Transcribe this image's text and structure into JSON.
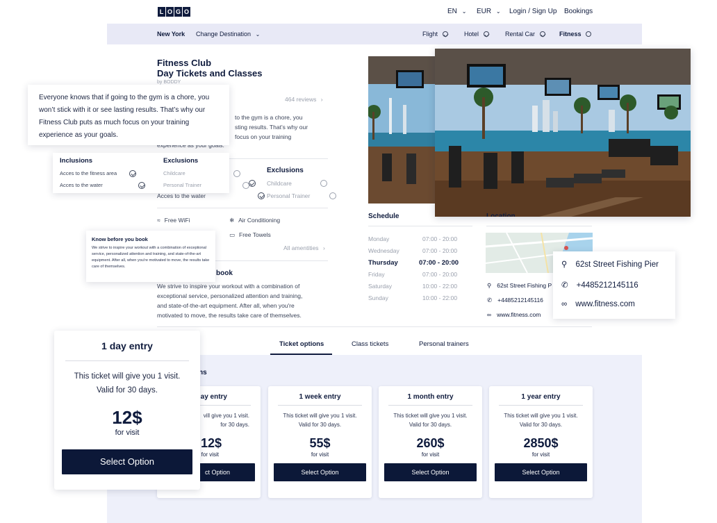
{
  "header": {
    "logo_letters": [
      "L",
      "O",
      "G",
      "O"
    ],
    "language": "EN",
    "currency": "EUR",
    "login_label": "Login / Sign Up",
    "bookings_label": "Bookings"
  },
  "subnav": {
    "city": "New York",
    "change_destination": "Change Destination",
    "items": [
      {
        "label": "Flight",
        "icon": "check-circle-icon"
      },
      {
        "label": "Hotel",
        "icon": "check-circle-icon"
      },
      {
        "label": "Rental Car",
        "icon": "check-circle-icon"
      },
      {
        "label": "Fitness",
        "icon": "empty-circle-icon"
      }
    ]
  },
  "listing": {
    "title_line1": "Fitness Club",
    "title_line2": "Day Tickets and Classes",
    "by": "by BODDY",
    "reviews": "464 reviews",
    "description_fragment": [
      "to the gym is a chore, you",
      "sting results. That’s why our",
      "focus on your training",
      "experience as your goals."
    ]
  },
  "popup_description": {
    "text": "Everyone knows that if going to the gym is a chore, you won’t stick with it or see lasting results. That’s why our Fitness Club puts as much focus on your training experience as your goals."
  },
  "inclusions_popup": {
    "inclusions_title": "Inclusions",
    "inclusions": [
      "Acces to the fitness area",
      "Acces to the water"
    ],
    "exclusions_title": "Exclusions",
    "exclusions": [
      "Childcare",
      "Personal Trainer"
    ]
  },
  "exclusions_main": {
    "title": "Exclusions",
    "items": [
      "Childcare",
      "Personal Trainer"
    ],
    "inclusion_fragment": "Acces to the water"
  },
  "amenities": {
    "items": [
      "Free WiFi",
      "Air Conditioning",
      "Free Towels"
    ],
    "all_label": "All amentities"
  },
  "know_popup": {
    "title": "Know before you book",
    "text": "We strive to inspire your workout with a combination of exceptional service, personalized attention and training, and state-of-the-art equipment. After all, when you're motivated to move, the results take care of themselves."
  },
  "know_main": {
    "title_fragment": "book",
    "lines": [
      "We strive to inspire your workout with a combination of",
      "exceptional service, personalized attention and training,",
      "and state-of-the-art equipment. After all, when you're",
      "motivated to move, the results take care of themselves."
    ]
  },
  "schedule": {
    "title": "Schedule",
    "rows": [
      {
        "day": "Monday",
        "hours": "07:00 - 20:00"
      },
      {
        "day": "Wednesday",
        "hours": "07:00 - 20:00"
      },
      {
        "day": "Thursday",
        "hours": "07:00 - 20:00"
      },
      {
        "day": "Friday",
        "hours": "07:00 - 20:00"
      },
      {
        "day": "Saturday",
        "hours": "10:00 - 22:00"
      },
      {
        "day": "Sunday",
        "hours": "10:00 - 22:00"
      }
    ],
    "current_day": "Thursday"
  },
  "location": {
    "title": "Location",
    "address": "62st Street Fishing Pier",
    "address_short": "62st Street Fishing P",
    "phone": "+4485212145116",
    "website": "www.fitness.com"
  },
  "tabs": {
    "items": [
      "Ticket options",
      "Class tickets",
      "Personal trainers"
    ],
    "active": "Ticket options",
    "section_title_fragment": "ns"
  },
  "tickets": [
    {
      "title": "1 day entry",
      "title_fragment": "ay entry",
      "desc1": "This ticket will give you 1 visit.",
      "desc2": "Valid for 30 days.",
      "desc1_fragment": "vill give you 1 visit.",
      "desc2_fragment": "for 30 days.",
      "price": "12$",
      "price_fragment": "12$",
      "for": "for visit",
      "for_fragment": "for visit",
      "button": "Select Option",
      "button_fragment": "ct Option"
    },
    {
      "title": "1 week entry",
      "desc1": "This ticket will give you 1 visit.",
      "desc2": "Valid for 30 days.",
      "price": "55$",
      "for": "for visit",
      "button": "Select Option"
    },
    {
      "title": "1 month entry",
      "desc1": "This ticket will give you 1 visit.",
      "desc2": "Valid for 30 days.",
      "price": "260$",
      "for": "for visit",
      "button": "Select Option"
    },
    {
      "title": "1 year entry",
      "desc1": "This ticket will give you 1 visit.",
      "desc2": "Valid for 30 days.",
      "price": "2850$",
      "for": "for visit",
      "button": "Select Option"
    }
  ],
  "colors": {
    "navy": "#0f1b3d",
    "button": "#0c1838",
    "subbar": "#e8e9f6",
    "section_bg": "#eef0fa",
    "muted": "#9aa0ad"
  }
}
